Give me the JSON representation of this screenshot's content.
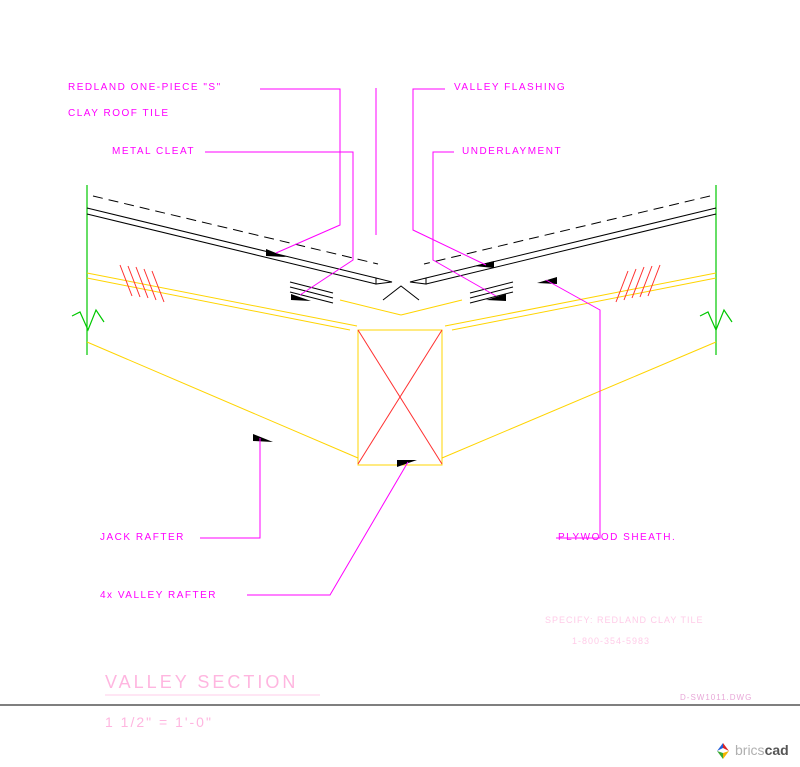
{
  "labels": {
    "tile_line1": "REDLAND ONE-PIECE \"S\"",
    "tile_line2": "CLAY ROOF TILE",
    "metal_cleat": "METAL CLEAT",
    "valley_flashing": "VALLEY FLASHING",
    "underlayment": "UNDERLAYMENT",
    "jack_rafter": "JACK RAFTER",
    "valley_rafter": "4x VALLEY RAFTER",
    "plywood_sheath": "PLYWOOD SHEATH."
  },
  "title": "VALLEY SECTION",
  "scale": "1 1/2\" = 1'-0\"",
  "spec_line1": "SPECIFY: REDLAND CLAY TILE",
  "spec_line2": "1-800-354-5983",
  "file": "D-SW1011.DWG",
  "brand_part1": "brics",
  "brand_part2": "cad"
}
